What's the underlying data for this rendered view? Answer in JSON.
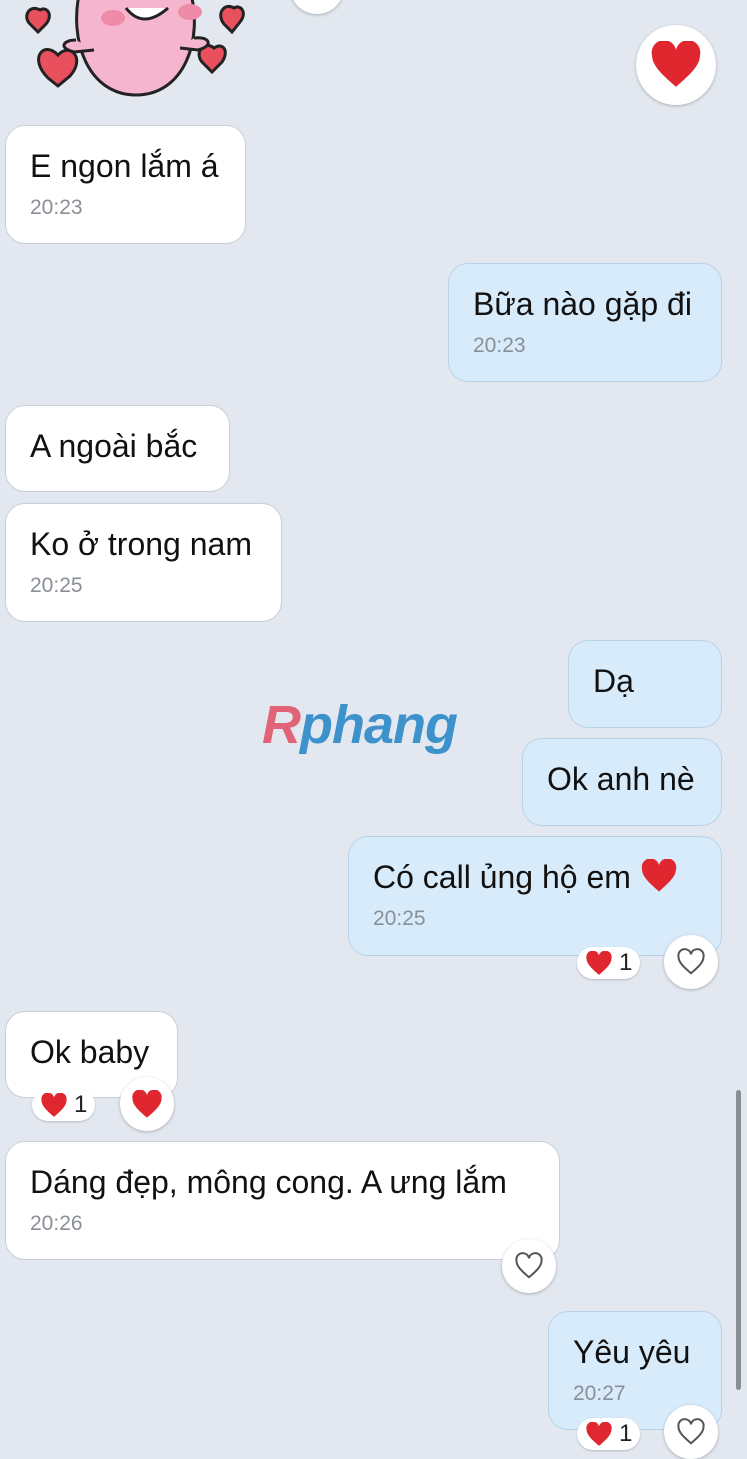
{
  "messages": [
    {
      "text": "E ngon lắm á",
      "time": "20:23"
    },
    {
      "text": "Bữa nào gặp đi",
      "time": "20:23"
    },
    {
      "text": "A ngoài bắc"
    },
    {
      "text": "Ko ở trong nam",
      "time": "20:25"
    },
    {
      "text": "Dạ"
    },
    {
      "text": "Ok anh nè"
    },
    {
      "text": "Có call ủng hộ em",
      "time": "20:25"
    },
    {
      "text": "Ok baby"
    },
    {
      "text": "Dáng đẹp, mông cong. A ưng lắm",
      "time": "20:26"
    },
    {
      "text": "Yêu yêu",
      "time": "20:27"
    }
  ],
  "reactions": {
    "call_count": "1",
    "baby_count": "1",
    "yeu_count": "1"
  },
  "watermark": {
    "first": "R",
    "rest": "phang"
  },
  "icons": {
    "sticker": "pink-cartoon-sticker-with-hearts",
    "heart_filled": "heart-filled-icon",
    "heart_outline": "heart-outline-icon"
  },
  "colors": {
    "background": "#e3e8f0",
    "incoming_bubble": "#ffffff",
    "outgoing_bubble": "#d8ebfb",
    "heart": "#e0262f"
  }
}
